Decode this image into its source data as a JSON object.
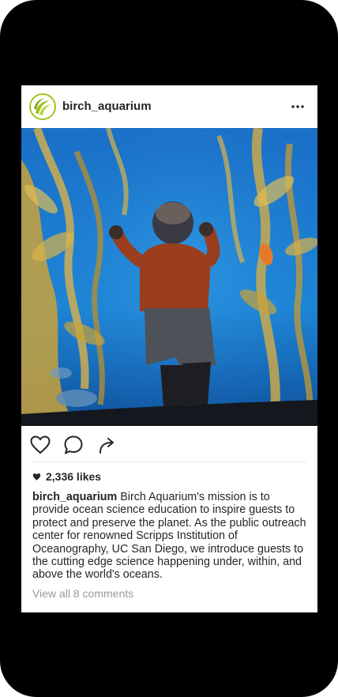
{
  "post": {
    "username": "birch_aquarium",
    "likes": "2,336 likes",
    "caption_user": "birch_aquarium",
    "caption_text": "Birch Aquarium's mission is to provide ocean science education to inspire guests to protect and preserve the planet. As the public outreach center for renowned Scripps Institution of Oceanography, UC San Diego, we introduce guests to the cutting edge science happening under, within, and above the world's oceans.",
    "view_comments": "View all 8 comments"
  },
  "icons": {
    "avatar": "birch-aquarium-logo-icon",
    "more": "more-options-icon",
    "like": "heart-icon",
    "comment": "comment-icon",
    "share": "share-icon",
    "likes_heart": "heart-filled-icon"
  },
  "colors": {
    "text": "#262626",
    "muted": "#999999",
    "logo_green": "#9cc21a",
    "water_blue": "#1e73c8"
  }
}
